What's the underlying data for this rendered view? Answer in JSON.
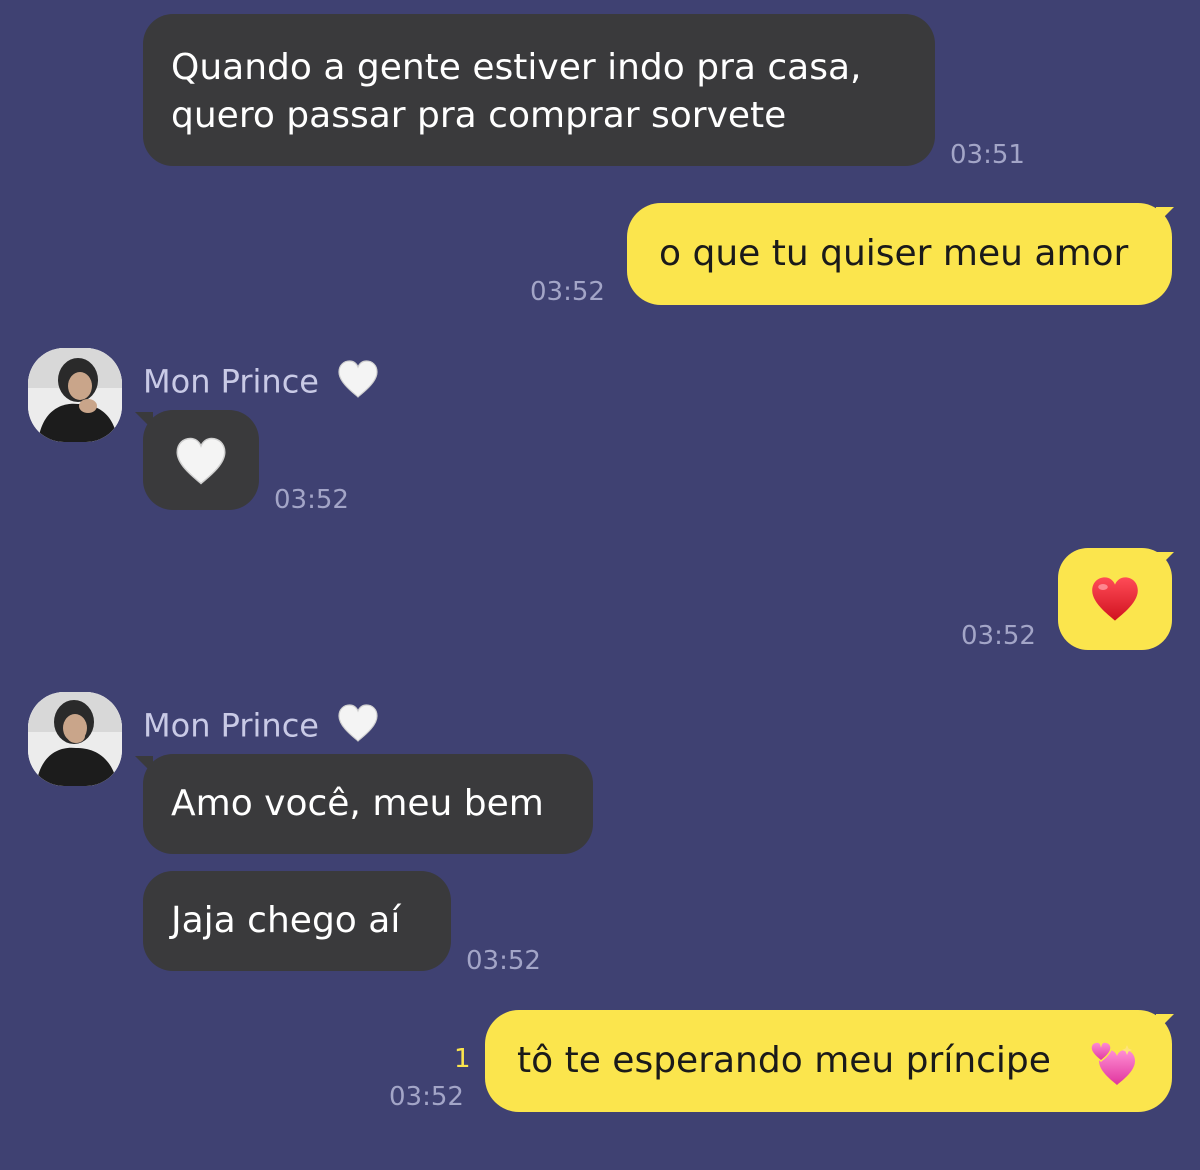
{
  "messages": [
    {
      "side": "in",
      "lines": [
        "Quando a gente estiver indo pra casa,",
        "quero passar pra comprar sorvete"
      ],
      "time": "03:51"
    },
    {
      "side": "out",
      "text": "o que tu quiser meu amor",
      "time": "03:52"
    },
    {
      "side": "in",
      "sender": "Mon Prince",
      "emoji": "white-heart",
      "time": "03:52"
    },
    {
      "side": "out",
      "emoji": "red-heart",
      "time": "03:52"
    },
    {
      "side": "in",
      "sender": "Mon Prince",
      "text": "Amo você, meu bem"
    },
    {
      "side": "in",
      "text": "Jaja chego aí",
      "time": "03:52"
    },
    {
      "side": "out",
      "text": "tô te esperando meu príncipe",
      "emoji": "two-hearts",
      "unread": "1",
      "time": "03:52"
    }
  ],
  "icons": {
    "sender_badge": "white-heart-icon",
    "bubble_emoji_1": "white-heart-icon",
    "bubble_emoji_2": "red-heart-icon",
    "bubble_emoji_3": "revolving-hearts-icon"
  },
  "colors": {
    "background": "#3f4172",
    "incoming_bubble": "#3a3a3c",
    "outgoing_bubble": "#fbe54d",
    "timestamp": "#a3a5c7",
    "unread_count": "#fbe54d"
  }
}
